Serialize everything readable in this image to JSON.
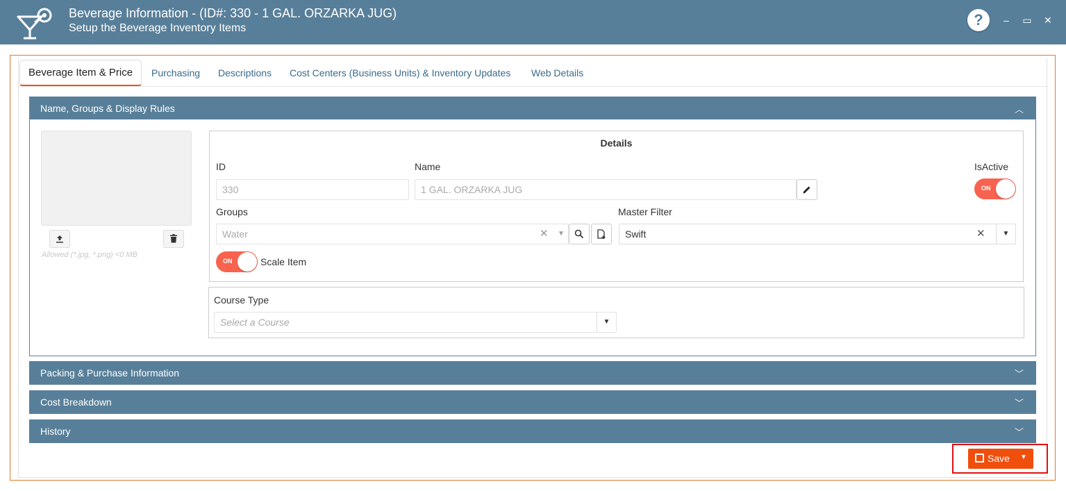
{
  "header": {
    "title": "Beverage Information - (ID#: 330 - 1 GAL. ORZARKA JUG)",
    "subtitle": "Setup the Beverage Inventory Items",
    "help_label": "?",
    "minimize_label": "–",
    "maximize_label": "▭",
    "close_label": "✕"
  },
  "tabs": [
    {
      "label": "Beverage Item & Price"
    },
    {
      "label": "Purchasing"
    },
    {
      "label": "Descriptions"
    },
    {
      "label": "Cost Centers (Business Units) & Inventory Updates"
    },
    {
      "label": "Web Details"
    }
  ],
  "sections": {
    "name_groups": "Name, Groups & Display Rules",
    "packing": "Packing & Purchase Information",
    "cost": "Cost Breakdown",
    "history": "History"
  },
  "image": {
    "allowed_text": "Allowed (*.jpg, *.png) <0 MB"
  },
  "details": {
    "title": "Details",
    "id_label": "ID",
    "id_value": "330",
    "name_label": "Name",
    "name_value": "1 GAL. ORZARKA JUG",
    "isactive_label": "IsActive",
    "isactive_toggle": "ON",
    "groups_label": "Groups",
    "groups_value": "Water",
    "master_filter_label": "Master Filter",
    "master_filter_value": "Swift",
    "scale_toggle": "ON",
    "scale_label": "Scale Item"
  },
  "course": {
    "label": "Course Type",
    "placeholder": "Select a Course"
  },
  "save": {
    "label": "Save"
  },
  "colors": {
    "header": "#587f99",
    "accent": "#f04e0c",
    "toggle": "#f7634f"
  }
}
